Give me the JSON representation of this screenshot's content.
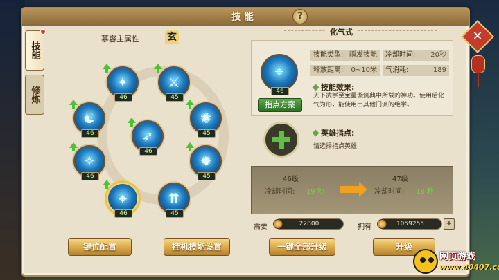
{
  "window": {
    "title": "技能",
    "help": "?",
    "close": "✕"
  },
  "tabs": [
    {
      "label": "技能",
      "active": true
    },
    {
      "label": "修炼",
      "active": false
    }
  ],
  "attribute": {
    "label": "慕容主属性",
    "value": "玄"
  },
  "skills": [
    {
      "id": "s1",
      "level": "46",
      "glyph": "✦",
      "upgradable": true
    },
    {
      "id": "s2",
      "level": "45",
      "glyph": "⚔",
      "upgradable": true
    },
    {
      "id": "s3",
      "level": "46",
      "glyph": "☯",
      "upgradable": true
    },
    {
      "id": "s4",
      "level": "45",
      "glyph": "✺",
      "upgradable": true
    },
    {
      "id": "s5",
      "level": "46",
      "glyph": "➶",
      "upgradable": true
    },
    {
      "id": "s6",
      "level": "46",
      "glyph": "✧",
      "upgradable": true
    },
    {
      "id": "s7",
      "level": "45",
      "glyph": "✹",
      "upgradable": true
    },
    {
      "id": "s8",
      "level": "46",
      "glyph": "⌖",
      "upgradable": true,
      "selected": true
    },
    {
      "id": "s9",
      "level": "45",
      "glyph": "⇈",
      "upgradable": false
    }
  ],
  "detail": {
    "name": "化气式",
    "level": "46",
    "skill_type_label": "技能类型:",
    "skill_type": "瞬发技能",
    "cooldown_label": "冷却时间:",
    "cooldown": "20秒",
    "range_label": "释放距离:",
    "range": "0~10米",
    "qi_label": "气消耗:",
    "qi": "189",
    "plan_button": "指点方案",
    "effect_title": "技能效果:",
    "effect_text": "天下武学至宝星璇剑典中所载的神功。使用后化气为形，能使用出其他门派的绝学。",
    "hero_title": "英雄指点:",
    "hero_desc": "请选择指点英雄"
  },
  "compare": {
    "current_level": "46级",
    "next_level": "47级",
    "current_key": "冷却时间:",
    "current_val": "19 秒",
    "next_key": "冷却时间:",
    "next_val": "18 秒"
  },
  "cost": {
    "need_label": "需要",
    "need_value": "22800",
    "have_label": "拥有",
    "have_value": "1059255",
    "plus": "+"
  },
  "buttons": {
    "keybind": "键位配置",
    "auto_skill": "挂机技能设置",
    "upgrade_all": "一键全部升级",
    "upgrade": "升级"
  },
  "watermark": {
    "line1": "网页游戏",
    "line2": "www.40407.com"
  }
}
